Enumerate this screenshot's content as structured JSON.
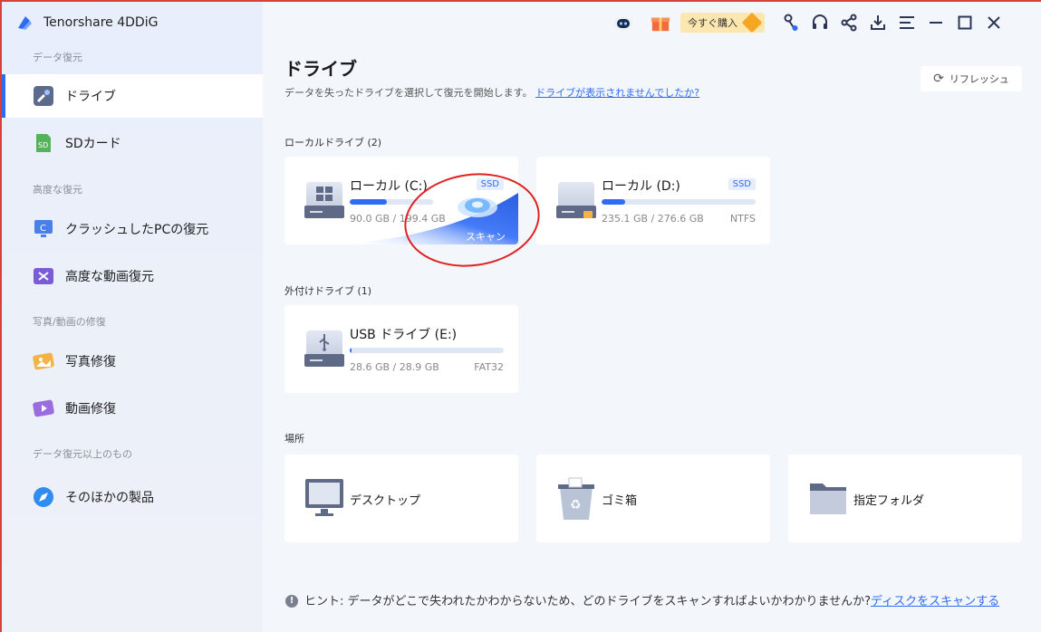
{
  "app": {
    "title": "Tenorshare 4DDiG"
  },
  "sidebar": {
    "sections": [
      {
        "label": "データ復元"
      },
      {
        "label": "高度な復元"
      },
      {
        "label": "写真/動画の修復"
      },
      {
        "label": "データ復元以上のもの"
      }
    ],
    "items": [
      {
        "label": "ドライブ",
        "icon": "drive-tools-icon",
        "active": true
      },
      {
        "label": "SDカード",
        "icon": "sd-card-icon"
      },
      {
        "label": "クラッシュしたPCの復元",
        "icon": "crashed-pc-icon"
      },
      {
        "label": "高度な動画復元",
        "icon": "advanced-video-icon"
      },
      {
        "label": "写真修復",
        "icon": "photo-repair-icon"
      },
      {
        "label": "動画修復",
        "icon": "video-repair-icon"
      },
      {
        "label": "そのほかの製品",
        "icon": "compass-icon"
      }
    ]
  },
  "topbar": {
    "buy_label": "今すぐ購入",
    "icons": [
      "robot-icon",
      "gift-icon",
      "key-icon",
      "headset-icon",
      "share-icon",
      "download-icon",
      "menu-icon",
      "minimize-icon",
      "maximize-icon",
      "close-icon"
    ]
  },
  "main": {
    "title": "ドライブ",
    "subtitle": "データを失ったドライブを選択して復元を開始します。",
    "subtitle_link": "ドライブが表示されませんでしたか?",
    "refresh_label": "リフレッシュ",
    "local_label": "ローカルドライブ (2)",
    "external_label": "外付けドライブ (1)",
    "places_label": "場所",
    "drives": [
      {
        "name": "ローカル (C:)",
        "tag": "SSD",
        "size": "90.0 GB / 199.4 GB",
        "used_fraction": 0.45,
        "scan_label": "スキャン"
      },
      {
        "name": "ローカル (D:)",
        "tag": "SSD",
        "size": "235.1 GB / 276.6 GB",
        "fs": "NTFS",
        "used_fraction": 0.15
      },
      {
        "name": "USB ドライブ (E:)",
        "size": "28.6 GB / 28.9 GB",
        "fs": "FAT32",
        "used_fraction": 0.01
      }
    ],
    "places": [
      {
        "label": "デスクトップ",
        "icon": "desktop-icon"
      },
      {
        "label": "ゴミ箱",
        "icon": "recycle-bin-icon"
      },
      {
        "label": "指定フォルダ",
        "icon": "folder-icon"
      }
    ]
  },
  "hint": {
    "prefix": "ヒント:",
    "text": "データがどこで失われたかわからないため、どのドライブをスキャンすればよいかわかりませんか?",
    "link": "ディスクをスキャンする"
  },
  "colors": {
    "accent": "#2f6cf6",
    "annotation": "#e02020"
  }
}
